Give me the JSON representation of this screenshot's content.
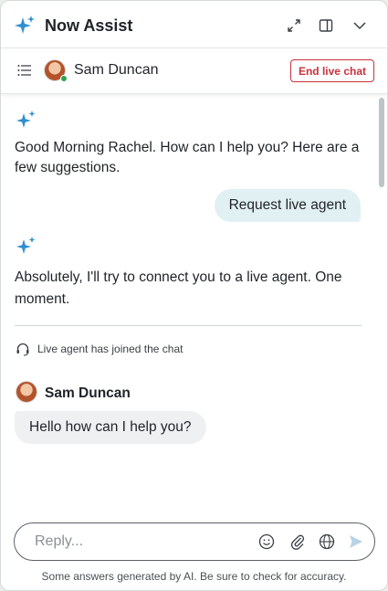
{
  "header": {
    "title": "Now Assist",
    "icons": [
      "sparkle-icon",
      "expand-icon",
      "side-panel-icon",
      "chevron-down-icon"
    ]
  },
  "agent_bar": {
    "agent_name": "Sam Duncan",
    "end_chat_label": "End live chat",
    "icons": [
      "menu-icon",
      "avatar",
      "online-status-dot"
    ]
  },
  "conversation": {
    "bot_greeting": "Good Morning Rachel. How can I help you? Here are a few suggestions.",
    "user_message": "Request live agent",
    "bot_reply": "Absolutely, I'll try to connect you to a live agent. One moment.",
    "system_notice": "Live agent has joined the chat",
    "agent_name": "Sam Duncan",
    "agent_message": "Hello how can I help you?"
  },
  "composer": {
    "placeholder": "Reply...",
    "icons": [
      "emoji-icon",
      "paperclip-icon",
      "globe-icon",
      "send-icon"
    ]
  },
  "footer": {
    "disclaimer": "Some answers generated by AI. Be sure to check for accuracy."
  },
  "colors": {
    "accent": "#2f8fd0",
    "danger": "#c8323c",
    "user_bubble": "#e1f0f3",
    "agent_bubble": "#eef0f2",
    "online": "#2ea44f"
  }
}
